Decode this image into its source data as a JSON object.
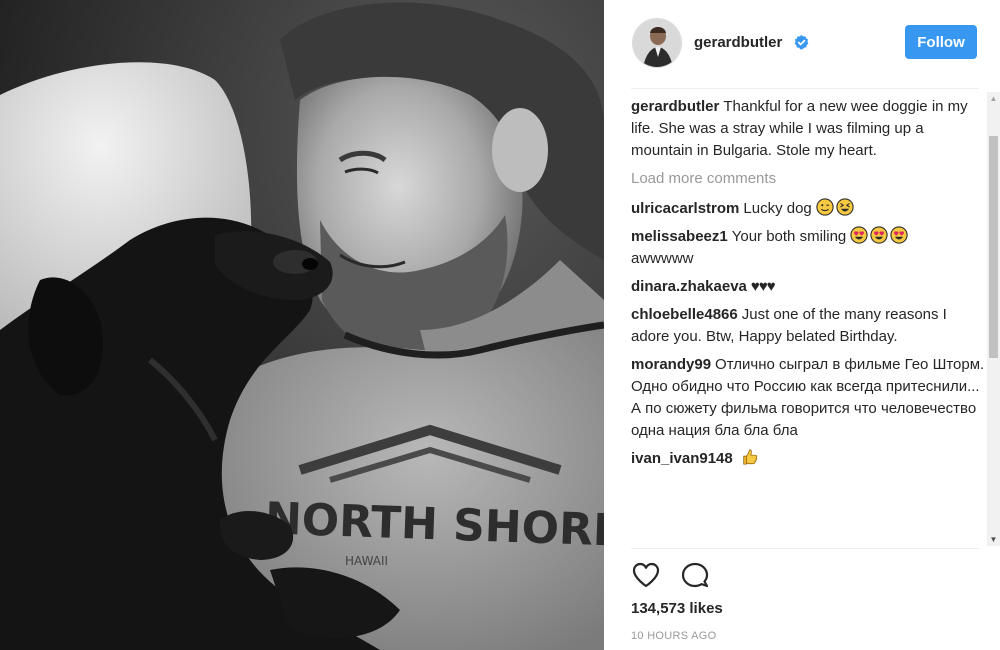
{
  "post": {
    "photo_shirt_text": "NORTH SHORE",
    "photo_shirt_subtext": "HAWAII"
  },
  "header": {
    "username": "gerardbutler",
    "follow_label": "Follow"
  },
  "caption": {
    "user": "gerardbutler",
    "text": "Thankful for a new wee doggie in my life. She was a stray while I was filming up a mountain in Bulgaria. Stole my heart."
  },
  "load_more_label": "Load more comments",
  "comments": [
    {
      "user": "ulricacarlstrom",
      "text": "Lucky dog",
      "emojis": [
        "wink-face",
        "squint-tongue-face"
      ]
    },
    {
      "user": "melissabeez1",
      "text": "Your both smiling",
      "emojis": [
        "heart-eyes-face",
        "heart-eyes-face",
        "heart-eyes-face"
      ],
      "text_after": "awwwww"
    },
    {
      "user": "dinara.zhakaeva",
      "text": "♥♥♥",
      "emojis": []
    },
    {
      "user": "chloebelle4866",
      "text": "Just one of the many reasons I adore you. Btw, Happy belated Birthday.",
      "emojis": []
    },
    {
      "user": "morandy99",
      "text": "Отлично сыграл в фильме Гео Шторм. Одно обидно что Россию как всегда притеснили... А по сюжету фильма говорится что человечество одна нация бла бла бла",
      "emojis": []
    },
    {
      "user": "ivan_ivan9148",
      "text": "",
      "emojis": [
        "thumbs-up"
      ]
    }
  ],
  "likes_label": "134,573 likes",
  "time_label": "10 HOURS AGO",
  "colors": {
    "follow_button": "#3897f0",
    "verified_badge": "#3897f0",
    "muted_text": "#999999",
    "divider": "#efefef"
  },
  "icons": [
    "verified-badge-icon",
    "heart-icon",
    "comment-bubble-icon",
    "scroll-up-arrow",
    "scroll-down-arrow"
  ]
}
